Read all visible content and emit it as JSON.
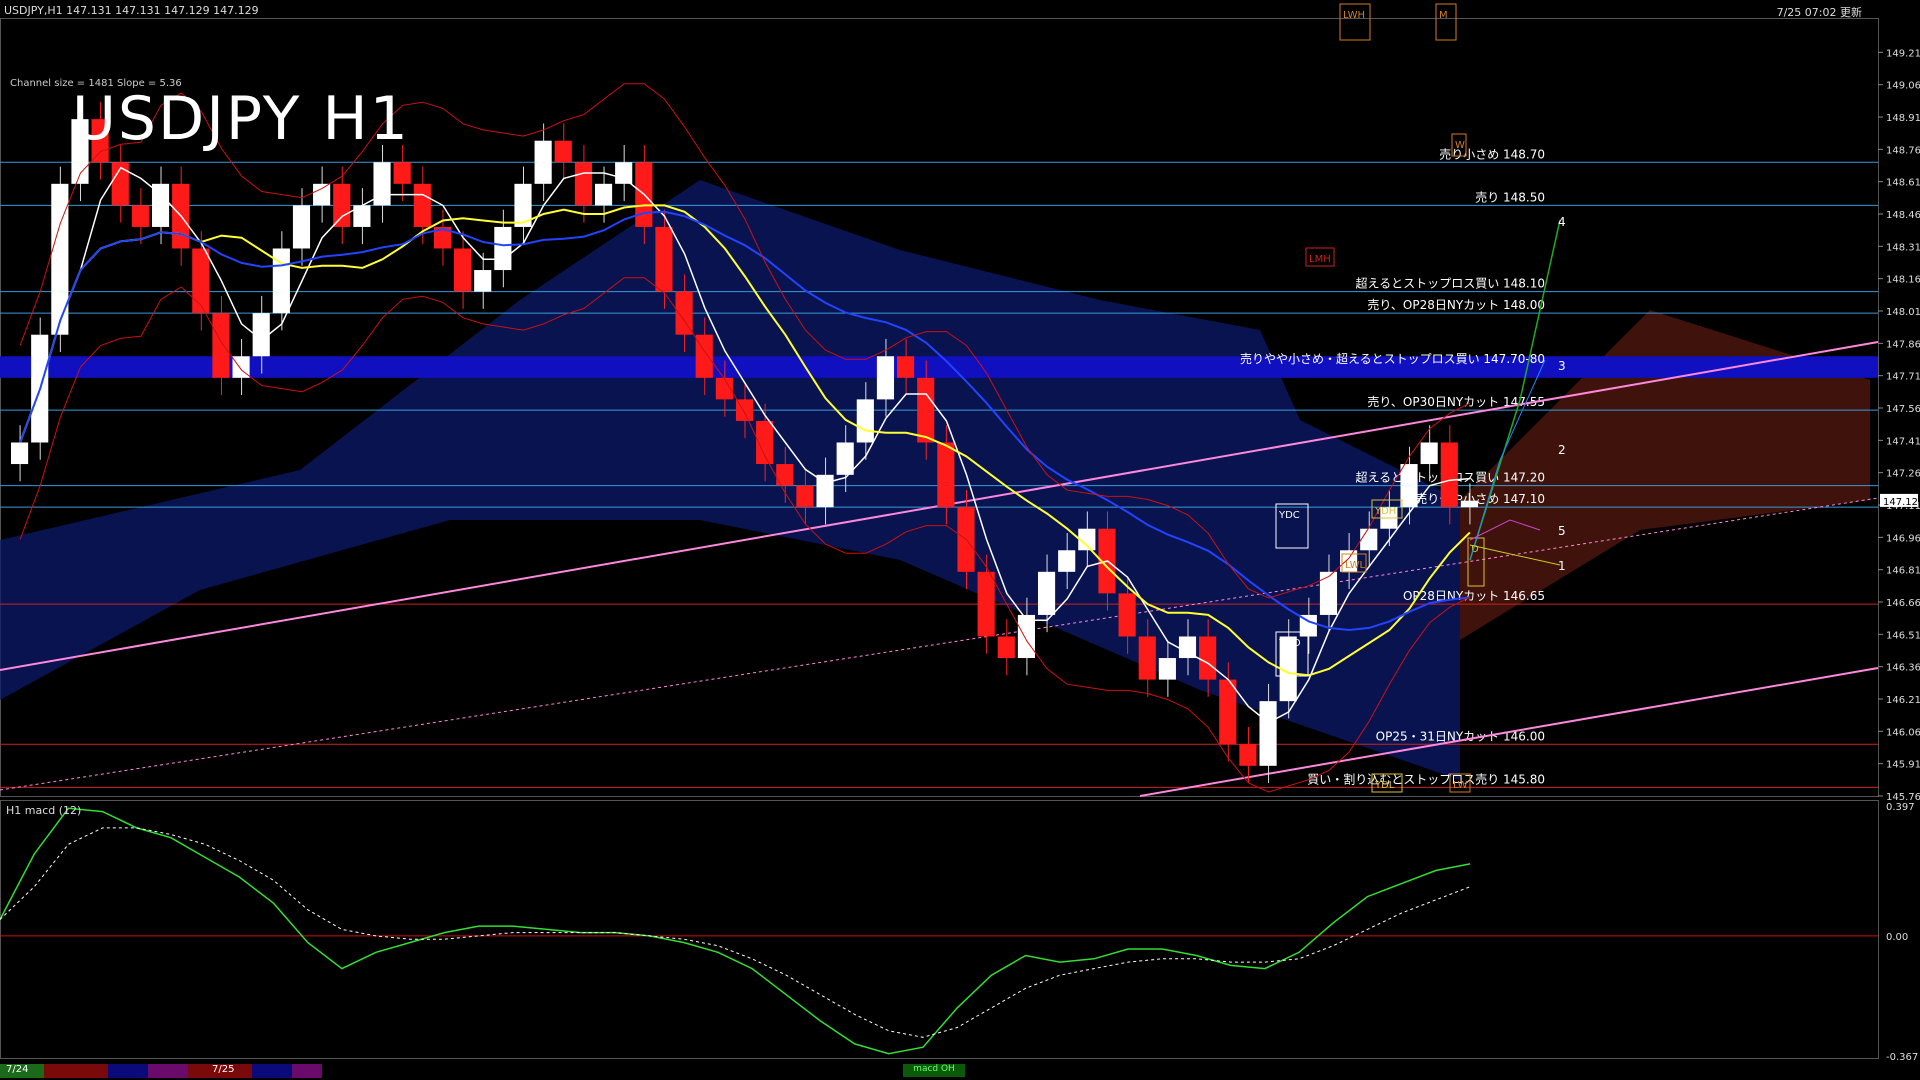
{
  "header": {
    "symbol_line": "USDJPY,H1  147.131 147.131 147.129 147.129",
    "timestamp": "7/25 07:02 更新",
    "title": "USDJPY H1",
    "channel_info": "Channel size = 1481  Slope = 5.36",
    "current_price_tag": "147.129"
  },
  "price_axis": {
    "min": 145.76,
    "max": 149.36,
    "ticks": [
      "149.210",
      "149.060",
      "148.910",
      "148.760",
      "148.610",
      "148.460",
      "148.310",
      "148.160",
      "148.010",
      "147.860",
      "147.710",
      "147.560",
      "147.410",
      "147.260",
      "147.110",
      "146.960",
      "146.810",
      "146.660",
      "146.510",
      "146.360",
      "146.210",
      "146.060",
      "145.910",
      "145.760"
    ]
  },
  "levels": [
    {
      "price": 148.7,
      "label": "売り小さめ 148.70",
      "color": "#3a9ad9"
    },
    {
      "price": 148.5,
      "label": "売り 148.50",
      "color": "#3a9ad9"
    },
    {
      "price": 148.1,
      "label": "超えるとストップロス買い 148.10",
      "color": "#3a9ad9"
    },
    {
      "price": 148.0,
      "label": "売り、OP28日NYカット 148.00",
      "color": "#3a9ad9"
    },
    {
      "price": 147.75,
      "label": "売りやや小さめ・超えるとストップロス買い 147.70-80",
      "color": "#2222cc"
    },
    {
      "price": 147.55,
      "label": "売り、OP30日NYカット 147.55",
      "color": "#3a9ad9"
    },
    {
      "price": 147.2,
      "label": "超えるとストップロス買い 147.20",
      "color": "#3a9ad9"
    },
    {
      "price": 147.1,
      "label": "売りやや小さめ 147.10",
      "color": "#3a9ad9"
    },
    {
      "price": 146.65,
      "label": "OP28日NYカット 146.65",
      "color": "#cc2222"
    },
    {
      "price": 146.0,
      "label": "OP25・31日NYカット 146.00",
      "color": "#cc2222"
    },
    {
      "price": 145.8,
      "label": "買い・割り込むとストップロス売り 145.80",
      "color": "#cc2222"
    }
  ],
  "boxes": [
    "LWH",
    "M",
    "W",
    "LMH",
    "YDH",
    "YDC",
    "YDO",
    "LWL",
    "YDL",
    "LW",
    "D"
  ],
  "projection_labels": [
    "4",
    "3",
    "2",
    "5",
    "1"
  ],
  "macd": {
    "label": "H1  macd (12)",
    "ticks": [
      "0.397",
      "0.00",
      "-0.367"
    ],
    "min": -0.367,
    "max": 0.397
  },
  "time_axis": {
    "labels": [
      "7/24",
      "7/25"
    ],
    "pill": "macd OH"
  },
  "chart_data": {
    "type": "candlestick",
    "title": "USDJPY H1",
    "ylim": [
      145.76,
      149.36
    ],
    "closes": [
      147.4,
      147.9,
      148.6,
      148.9,
      148.7,
      148.5,
      148.4,
      148.6,
      148.3,
      148.0,
      147.7,
      147.8,
      148.0,
      148.3,
      148.5,
      148.6,
      148.4,
      148.5,
      148.7,
      148.6,
      148.4,
      148.3,
      148.1,
      148.2,
      148.4,
      148.6,
      148.8,
      148.7,
      148.5,
      148.6,
      148.7,
      148.4,
      148.1,
      147.9,
      147.7,
      147.6,
      147.5,
      147.3,
      147.2,
      147.1,
      147.25,
      147.4,
      147.6,
      147.8,
      147.7,
      147.4,
      147.1,
      146.8,
      146.5,
      146.4,
      146.6,
      146.8,
      146.9,
      147.0,
      146.7,
      146.5,
      146.3,
      146.4,
      146.5,
      146.3,
      146.0,
      145.9,
      146.2,
      146.5,
      146.6,
      146.8,
      146.9,
      147.0,
      147.1,
      147.3,
      147.4,
      147.1,
      147.13
    ],
    "macd_series": [
      0.05,
      0.25,
      0.39,
      0.38,
      0.33,
      0.3,
      0.24,
      0.18,
      0.1,
      -0.02,
      -0.1,
      -0.05,
      -0.02,
      0.01,
      0.03,
      0.03,
      0.02,
      0.01,
      0.01,
      0.0,
      -0.02,
      -0.05,
      -0.1,
      -0.18,
      -0.26,
      -0.33,
      -0.36,
      -0.34,
      -0.22,
      -0.12,
      -0.06,
      -0.08,
      -0.07,
      -0.04,
      -0.04,
      -0.06,
      -0.09,
      -0.1,
      -0.05,
      0.04,
      0.12,
      0.16,
      0.2,
      0.22
    ],
    "signal_series": [
      0.05,
      0.15,
      0.28,
      0.33,
      0.33,
      0.31,
      0.28,
      0.23,
      0.17,
      0.08,
      0.02,
      0.0,
      -0.01,
      -0.01,
      0.0,
      0.01,
      0.01,
      0.01,
      0.01,
      0.0,
      -0.01,
      -0.03,
      -0.07,
      -0.12,
      -0.18,
      -0.24,
      -0.29,
      -0.31,
      -0.28,
      -0.22,
      -0.16,
      -0.12,
      -0.1,
      -0.08,
      -0.07,
      -0.07,
      -0.08,
      -0.08,
      -0.07,
      -0.03,
      0.02,
      0.07,
      0.11,
      0.15
    ]
  }
}
